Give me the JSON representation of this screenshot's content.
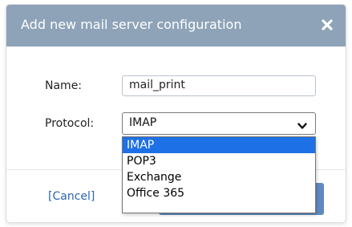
{
  "dialog": {
    "title": "Add new mail server configuration",
    "close_icon": "close-x-icon",
    "titlebar_color": "#8ea3b8"
  },
  "form": {
    "name_label": "Name:",
    "name_value": "mail_print",
    "protocol_label": "Protocol:",
    "protocol_selected": "IMAP",
    "protocol_options": [
      "IMAP",
      "POP3",
      "Exchange",
      "Office 365"
    ],
    "protocol_highlighted": "IMAP"
  },
  "footer": {
    "cancel_label": "[Cancel]",
    "primary_button_color": "#5e89c2"
  },
  "colors": {
    "link": "#2e64b5",
    "option_highlight": "#1e70e6"
  }
}
